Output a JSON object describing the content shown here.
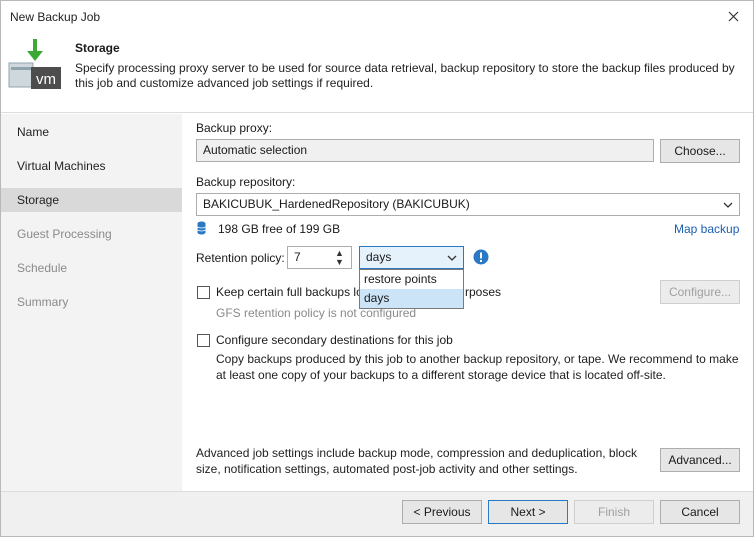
{
  "window": {
    "title": "New Backup Job"
  },
  "header": {
    "title": "Storage",
    "description": "Specify processing proxy server to be used for source data retrieval, backup repository to store the backup files produced by this job and customize advanced job settings if required.",
    "icon_text": "vm"
  },
  "sidebar": {
    "items": [
      {
        "label": "Name"
      },
      {
        "label": "Virtual Machines"
      },
      {
        "label": "Storage"
      },
      {
        "label": "Guest Processing"
      },
      {
        "label": "Schedule"
      },
      {
        "label": "Summary"
      }
    ]
  },
  "storage": {
    "proxy_label": "Backup proxy:",
    "proxy_value": "Automatic selection",
    "choose_label": "Choose...",
    "repo_label": "Backup repository:",
    "repo_value": "BAKICUBUK_HardenedRepository (BAKICUBUK)",
    "free_space": "198 GB free of 199 GB",
    "map_backup": "Map backup",
    "retention_label": "Retention policy:",
    "retention_value": "7",
    "retention_unit": "days",
    "retention_options": [
      "restore points",
      "days"
    ],
    "gfs_check_label_a": "Keep certain full backups lo",
    "gfs_check_label_b": "rposes",
    "gfs_note": "GFS retention policy is not configured",
    "configure_label": "Configure...",
    "secondary_check_label": "Configure secondary destinations for this job",
    "secondary_desc": "Copy backups produced by this job to another backup repository, or tape. We recommend to make at least one copy of your backups to a different storage device that is located off-site.",
    "advanced_desc": "Advanced job settings include backup mode, compression and deduplication, block size, notification settings, automated post-job activity and other settings.",
    "advanced_label": "Advanced..."
  },
  "footer": {
    "previous": "< Previous",
    "next": "Next >",
    "finish": "Finish",
    "cancel": "Cancel"
  },
  "colors": {
    "accent": "#2b78c5",
    "link": "#1a5fb4",
    "info": "#2b78c5",
    "veeam_green": "#3aaa35"
  }
}
